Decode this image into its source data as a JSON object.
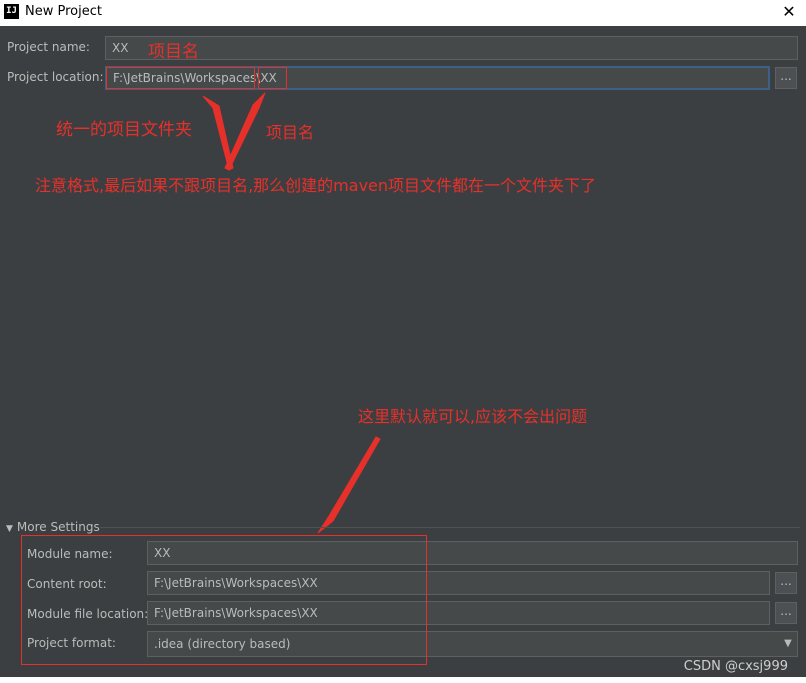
{
  "window": {
    "title": "New Project",
    "app_icon": "IJ",
    "close_glyph": "✕"
  },
  "project": {
    "name_label": "Project name:",
    "name_value": "XX",
    "location_label": "Project location:",
    "location_value": "F:\\JetBrains\\Workspaces\\XX",
    "browse_label": "..."
  },
  "annotations": {
    "name_note": "项目名",
    "folder_note": "统一的项目文件夹",
    "project_name_note": "项目名",
    "format_note": "注意格式,最后如果不跟项目名,那么创建的maven项目文件都在一个文件夹下了",
    "defaults_note": "这里默认就可以,应该不会出问题",
    "color": "#e8302a"
  },
  "more_settings": {
    "title": "More Settings",
    "module_name_label": "Module name:",
    "module_name_value": "XX",
    "content_root_label": "Content root:",
    "content_root_value": "F:\\JetBrains\\Workspaces\\XX",
    "module_file_location_label": "Module file location:",
    "module_file_location_value": "F:\\JetBrains\\Workspaces\\XX",
    "project_format_label": "Project format:",
    "project_format_value": ".idea (directory based)",
    "browse_label": "..."
  },
  "watermark": "CSDN @cxsj999"
}
